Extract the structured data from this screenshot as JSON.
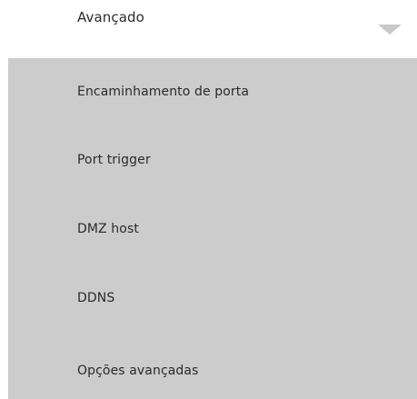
{
  "dropdown": {
    "title": "Avançado",
    "chevron_icon": "chevron-down-icon",
    "chevron_color": "#c9c9c9"
  },
  "menu": {
    "background": "#cccccc",
    "items": [
      {
        "label": "Encaminhamento de porta"
      },
      {
        "label": "Port trigger"
      },
      {
        "label": "DMZ host"
      },
      {
        "label": "DDNS"
      },
      {
        "label": "Opções avançadas"
      }
    ]
  }
}
